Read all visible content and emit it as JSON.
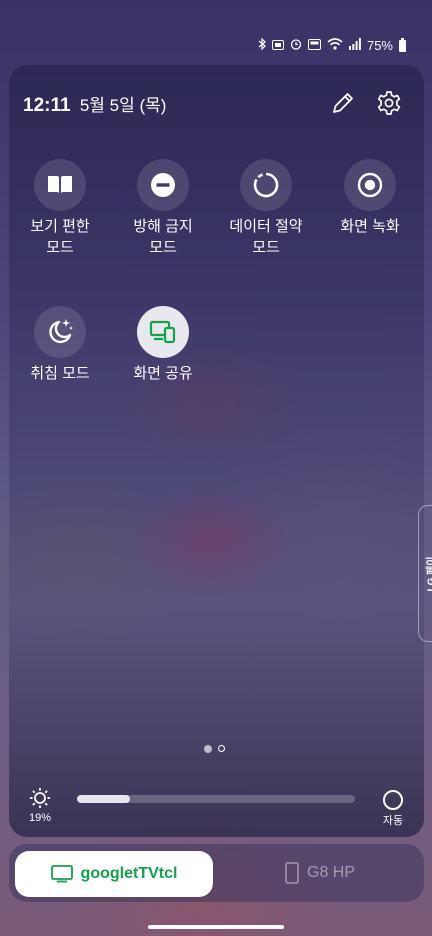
{
  "status_bar": {
    "battery": "75%"
  },
  "header": {
    "time": "12:11",
    "date": "5월 5일 (목)"
  },
  "tiles": [
    {
      "label": "보기 편한\n모드",
      "icon": "book-icon"
    },
    {
      "label": "방해 금지\n모드",
      "icon": "do-not-disturb-icon"
    },
    {
      "label": "데이터 절약\n모드",
      "icon": "data-saver-icon"
    },
    {
      "label": "화면 녹화",
      "icon": "screen-record-icon"
    },
    {
      "label": "취침 모드",
      "icon": "bedtime-icon"
    },
    {
      "label": "화면 공유",
      "icon": "screen-share-icon",
      "active": true
    }
  ],
  "brightness": {
    "percent_label": "19%",
    "level": 0.19,
    "auto_label": "자동"
  },
  "devices": {
    "active": "googletTVtcl",
    "other": "G8 HP"
  },
  "side_panel": {
    "label": "LG 페이"
  },
  "colors": {
    "accent_green": "#12a24b"
  }
}
